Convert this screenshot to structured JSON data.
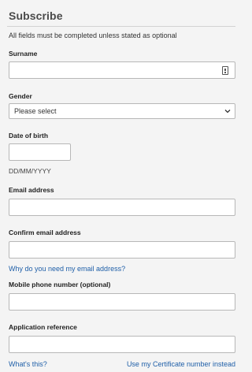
{
  "form": {
    "title": "Subscribe",
    "intro": "All fields must be completed unless stated as optional",
    "surname_label": "Surname",
    "gender_label": "Gender",
    "gender_selected": "Please select",
    "dob_label": "Date of birth",
    "dob_hint": "DD/MM/YYYY",
    "email_label": "Email address",
    "confirm_email_label": "Confirm email address",
    "why_email_link": "Why do you need my email address?",
    "mobile_label": "Mobile phone number (optional)",
    "app_ref_label": "Application reference",
    "whats_this_link": "What's this?",
    "certificate_link": "Use my Certificate number instead"
  }
}
